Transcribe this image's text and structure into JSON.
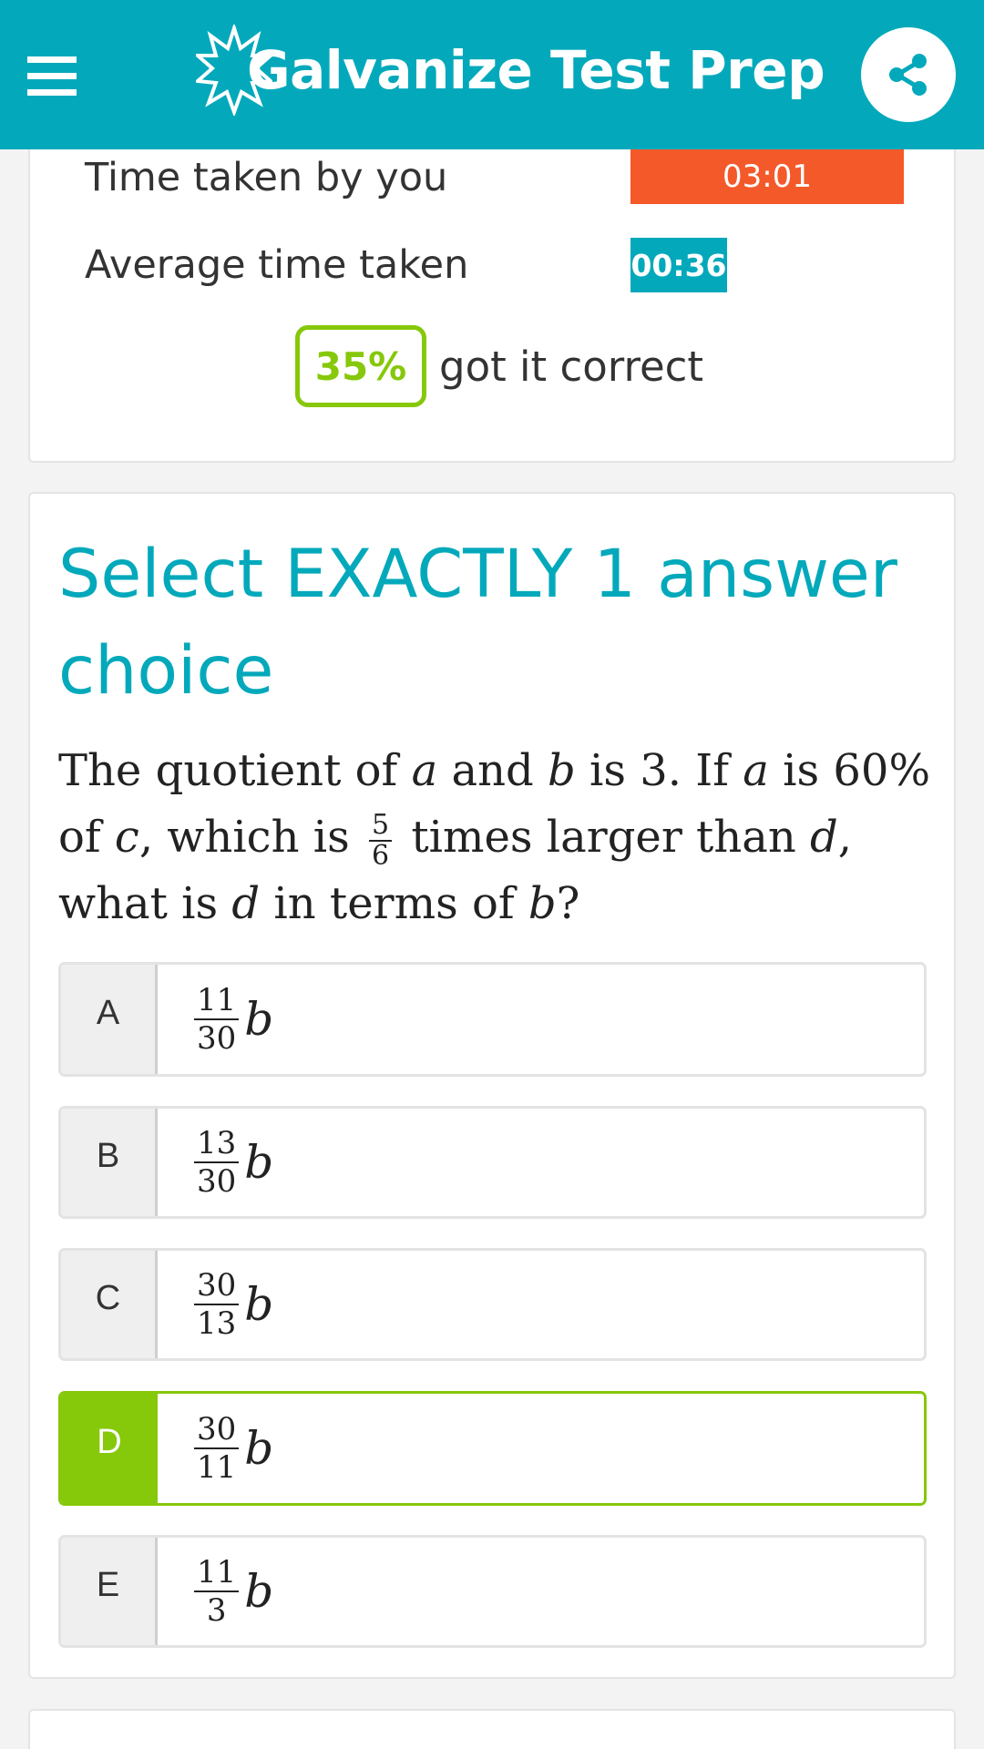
{
  "header": {
    "title": "Galvanize Test Prep",
    "colors": {
      "header_bg": "#03a9bb"
    },
    "menu_icon": "hamburger-menu-icon",
    "share_icon": "share-icon"
  },
  "stats": {
    "time_you_label": "Time taken by you",
    "time_you_value": "03:01",
    "avg_time_label": "Average time taken",
    "avg_time_value": "00:36",
    "percent_correct": "35%",
    "percent_correct_text": "got it correct",
    "colors": {
      "time_you_bar": "#f4592a",
      "avg_time_bar": "#03a9bb",
      "correct_badge": "#86c80a"
    }
  },
  "question": {
    "instruction": "Select EXACTLY 1 answer choice",
    "text": {
      "t1": "The quotient of ",
      "v_a": "a",
      "t2": " and ",
      "v_b": "b",
      "t3": " is 3. If ",
      "v_a2": "a",
      "t4": " is 60% of ",
      "v_c": "c",
      "t5": ", which is ",
      "frac_num": "5",
      "frac_den": "6",
      "t6": " times larger than ",
      "v_d": "d",
      "t7": ", what is ",
      "v_d2": "d",
      "t8": " in terms of ",
      "v_b2": "b",
      "t9": "?"
    },
    "choices": [
      {
        "letter": "A",
        "num": "11",
        "den": "30",
        "var": "b"
      },
      {
        "letter": "B",
        "num": "13",
        "den": "30",
        "var": "b"
      },
      {
        "letter": "C",
        "num": "30",
        "den": "13",
        "var": "b"
      },
      {
        "letter": "D",
        "num": "30",
        "den": "11",
        "var": "b",
        "selected": true
      },
      {
        "letter": "E",
        "num": "11",
        "den": "3",
        "var": "b"
      }
    ],
    "colors": {
      "selected": "#86c80a"
    }
  }
}
